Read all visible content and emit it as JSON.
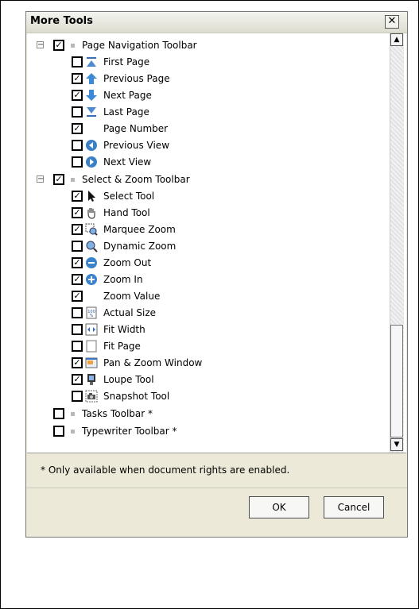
{
  "dialog": {
    "title": "More Tools",
    "close_label": "✕",
    "footnote": "* Only available when document rights are enabled.",
    "ok_label": "OK",
    "cancel_label": "Cancel",
    "scroll_up": "▲",
    "scroll_down": "▼"
  },
  "tree": {
    "page_navigation": {
      "label": "Page Navigation Toolbar",
      "checked": true,
      "items": [
        {
          "label": "First Page",
          "checked": false,
          "icon": "first-page-icon"
        },
        {
          "label": "Previous Page",
          "checked": true,
          "icon": "previous-page-icon"
        },
        {
          "label": "Next Page",
          "checked": true,
          "icon": "next-page-icon"
        },
        {
          "label": "Last Page",
          "checked": false,
          "icon": "last-page-icon"
        },
        {
          "label": "Page Number",
          "checked": true,
          "icon": ""
        },
        {
          "label": "Previous View",
          "checked": false,
          "icon": "previous-view-icon"
        },
        {
          "label": "Next View",
          "checked": false,
          "icon": "next-view-icon"
        }
      ]
    },
    "select_zoom": {
      "label": "Select & Zoom Toolbar",
      "checked": true,
      "items": [
        {
          "label": "Select Tool",
          "checked": true,
          "icon": "arrow-cursor-icon"
        },
        {
          "label": "Hand Tool",
          "checked": true,
          "icon": "hand-icon"
        },
        {
          "label": "Marquee Zoom",
          "checked": true,
          "icon": "marquee-zoom-icon"
        },
        {
          "label": "Dynamic Zoom",
          "checked": false,
          "icon": "dynamic-zoom-icon"
        },
        {
          "label": "Zoom Out",
          "checked": true,
          "icon": "zoom-out-icon"
        },
        {
          "label": "Zoom In",
          "checked": true,
          "icon": "zoom-in-icon"
        },
        {
          "label": "Zoom Value",
          "checked": true,
          "icon": ""
        },
        {
          "label": "Actual Size",
          "checked": false,
          "icon": "actual-size-icon"
        },
        {
          "label": "Fit Width",
          "checked": false,
          "icon": "fit-width-icon"
        },
        {
          "label": "Fit Page",
          "checked": false,
          "icon": "fit-page-icon"
        },
        {
          "label": "Pan & Zoom Window",
          "checked": true,
          "icon": "pan-zoom-window-icon"
        },
        {
          "label": "Loupe Tool",
          "checked": true,
          "icon": "loupe-icon"
        },
        {
          "label": "Snapshot Tool",
          "checked": false,
          "icon": "snapshot-camera-icon"
        }
      ]
    },
    "tasks": {
      "label": "Tasks Toolbar *",
      "checked": false
    },
    "typewriter": {
      "label": "Typewriter Toolbar *",
      "checked": false
    }
  },
  "colors": {
    "titlebar": "#dcdcd0",
    "dialog": "#ece9d8",
    "check": "#000000"
  }
}
